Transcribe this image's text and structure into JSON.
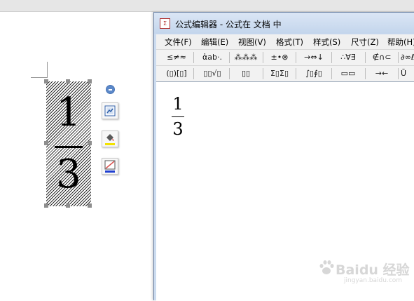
{
  "document": {
    "equation": {
      "numerator": "1",
      "denominator": "3"
    }
  },
  "floating_toolbar": {
    "items": [
      {
        "icon": "minus-circle-icon"
      },
      {
        "icon": "image-layout-icon"
      },
      {
        "icon": "fill-bucket-icon"
      },
      {
        "icon": "line-color-icon"
      }
    ]
  },
  "editor": {
    "title": "公式编辑器 - 公式在 文档 中",
    "app_icon_glyph": "Σ",
    "menu": [
      "文件(F)",
      "编辑(E)",
      "视图(V)",
      "格式(T)",
      "样式(S)",
      "尺寸(Z)",
      "帮助(H)"
    ],
    "palette_row1": [
      "≤≠≈",
      "ἀab·.",
      "⁂⁂⁂",
      "±•⊗",
      "→⇔↓",
      "∴∀∃",
      "∉∩⊂",
      "∂∞ℓ"
    ],
    "palette_row2": [
      "(▯)[▯]",
      "▯▯√▯",
      "▯▯",
      "Σ▯Σ▯",
      "∫▯∮▯",
      "▭▭",
      "→←",
      "Ū"
    ],
    "canvas": {
      "numerator": "1",
      "denominator": "3"
    }
  },
  "watermark": {
    "text": "Baidu 经验",
    "sub": "jingyan.baidu.com"
  }
}
